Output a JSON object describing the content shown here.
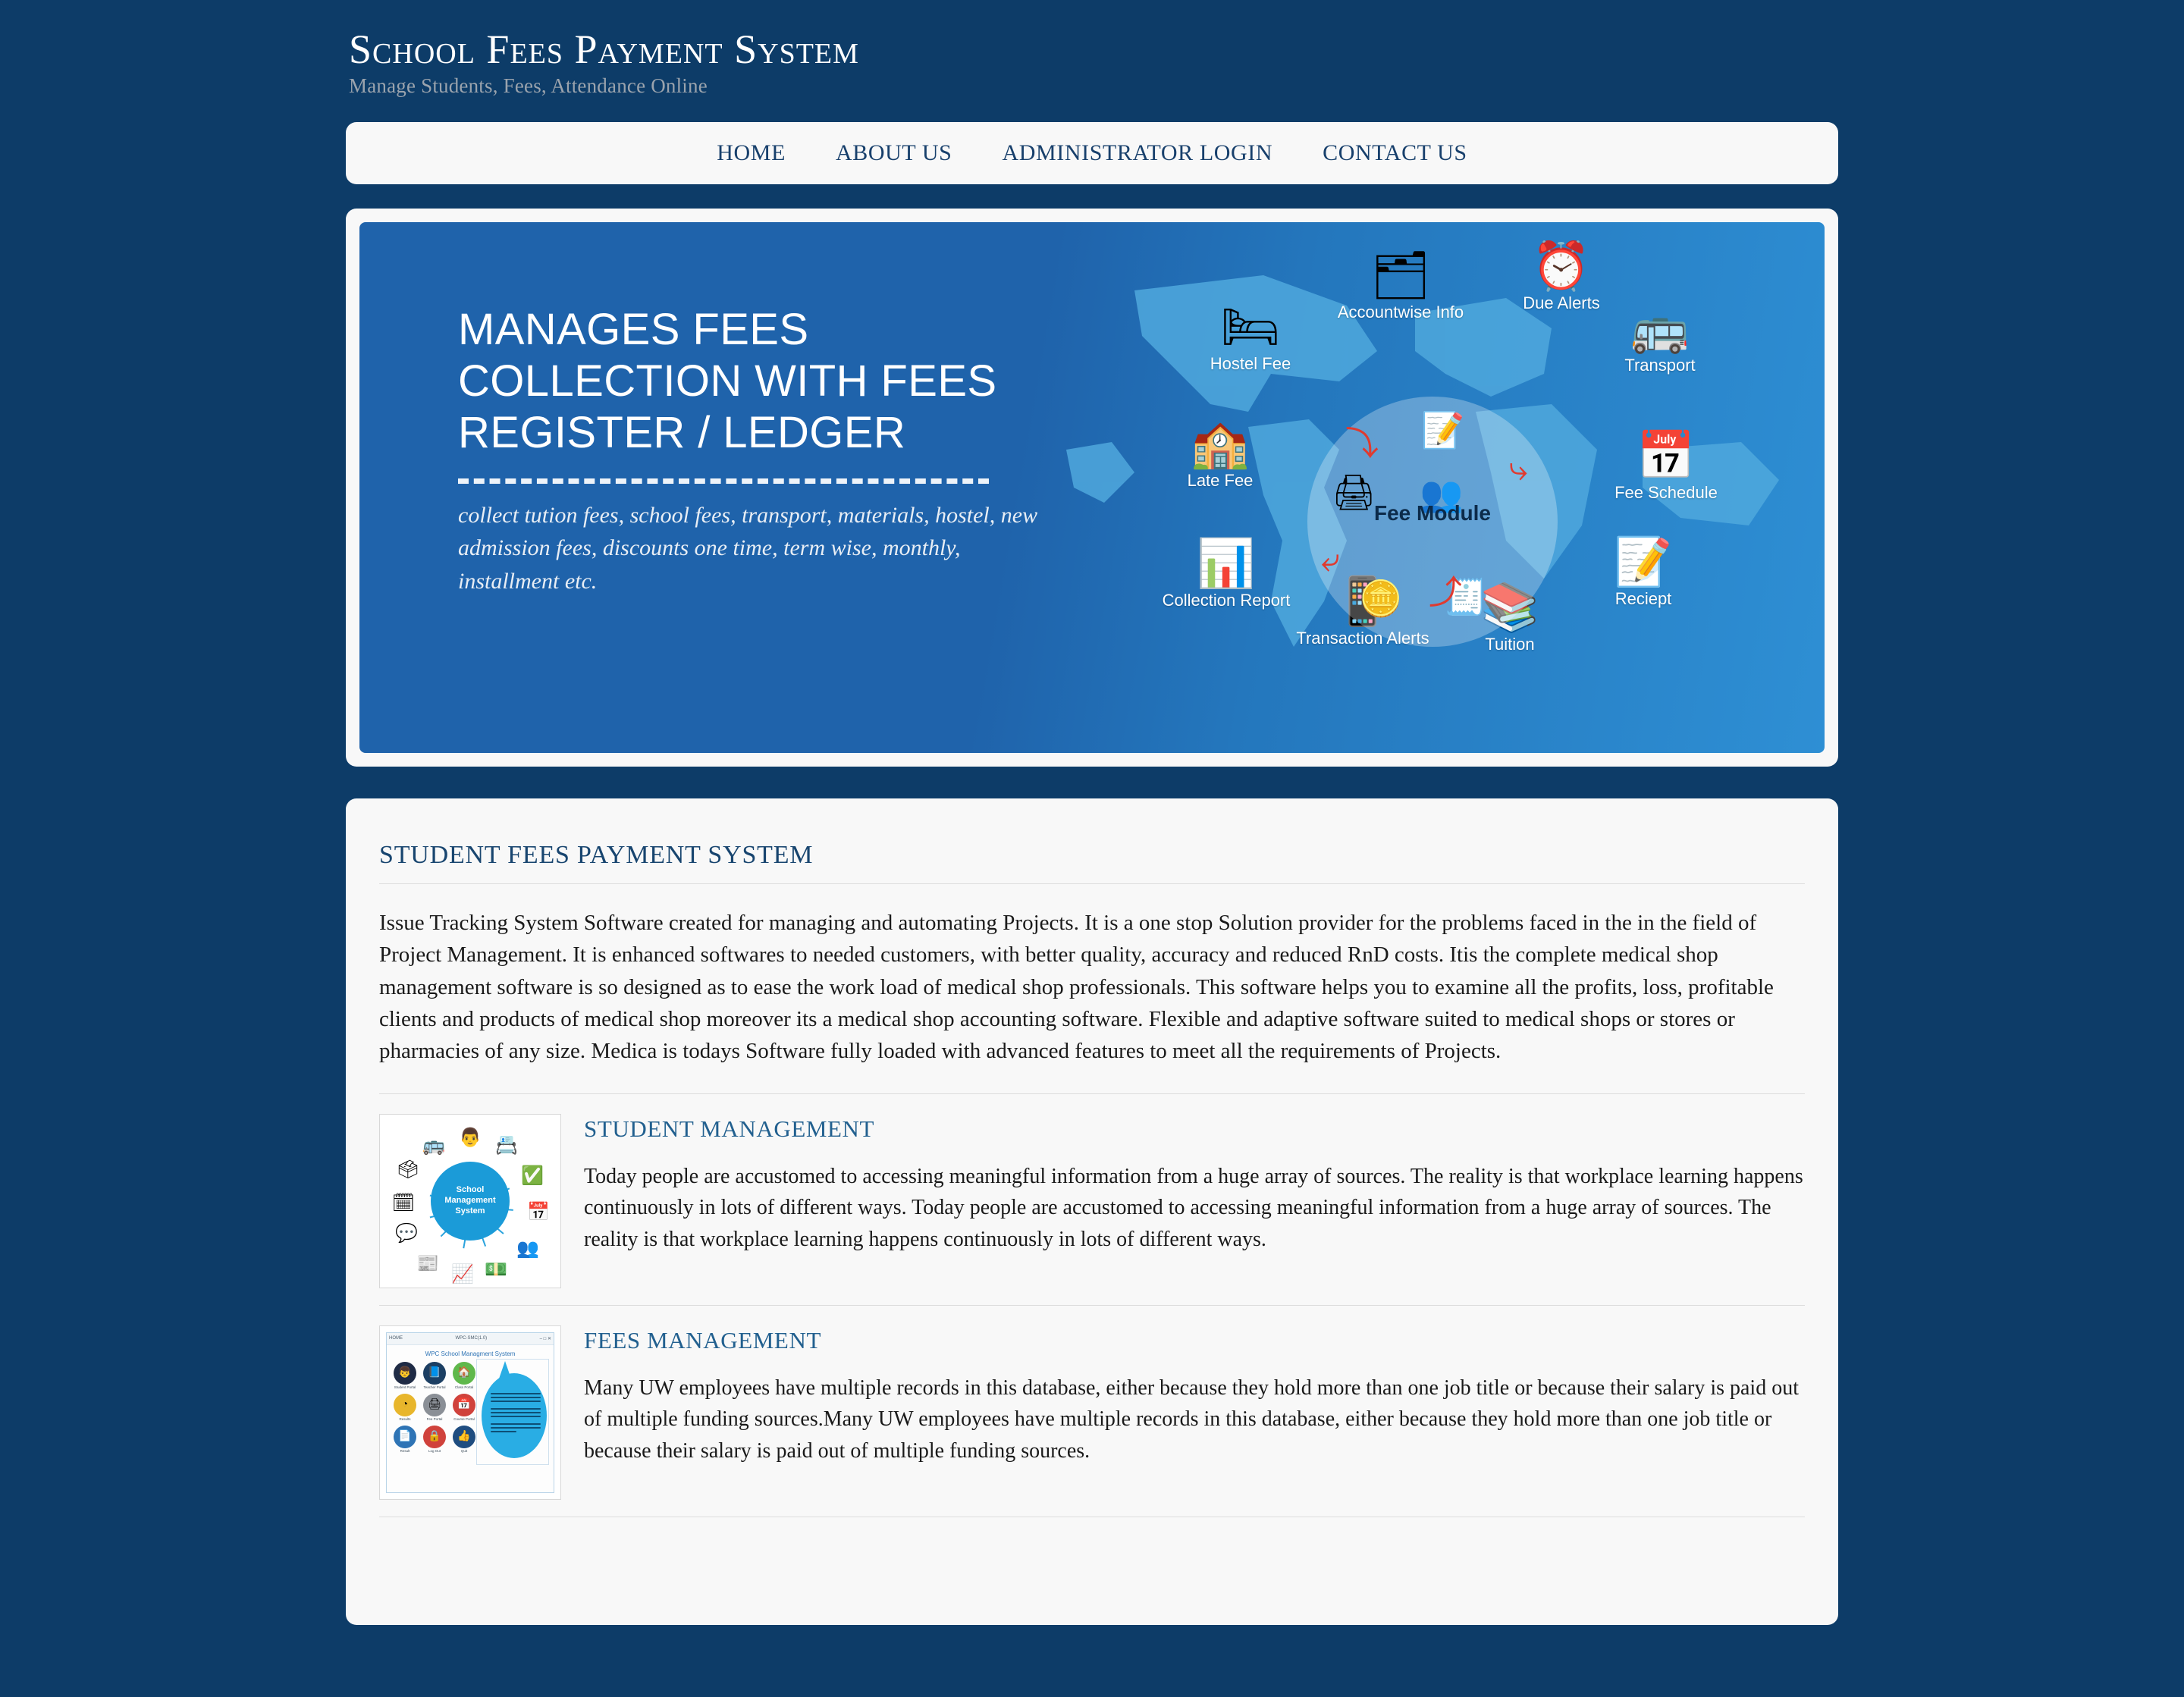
{
  "header": {
    "title": "School Fees Payment System",
    "tagline": "Manage Students, Fees, Attendance Online"
  },
  "nav": {
    "items": [
      {
        "label": "HOME"
      },
      {
        "label": "ABOUT US"
      },
      {
        "label": "ADMINISTRATOR LOGIN"
      },
      {
        "label": "CONTACT US"
      }
    ]
  },
  "banner": {
    "headline": "MANAGES FEES COLLECTION WITH FEES REGISTER / LEDGER",
    "subtext": "collect tution fees, school fees, transport, materials, hostel, new admission fees, discounts one time, term wise, monthly, installment etc.",
    "hub_label": "Fee Module",
    "nodes": [
      {
        "label": "Accountwise Info",
        "icon": "folder-documents-icon",
        "glyph": "🗂"
      },
      {
        "label": "Due Alerts",
        "icon": "alarm-clock-icon",
        "glyph": "⏰"
      },
      {
        "label": "Hostel Fee",
        "icon": "bunk-bed-icon",
        "glyph": "🛏"
      },
      {
        "label": "Transport",
        "icon": "school-bus-icon",
        "glyph": "🚌"
      },
      {
        "label": "Late Fee",
        "icon": "school-building-icon",
        "glyph": "🏫"
      },
      {
        "label": "Fee Schedule",
        "icon": "calendar-clock-icon",
        "glyph": "📅"
      },
      {
        "label": "Collection Report",
        "icon": "bar-chart-report-icon",
        "glyph": "📊"
      },
      {
        "label": "Reciept",
        "icon": "receipt-pen-icon",
        "glyph": "📝"
      },
      {
        "label": "Transaction Alerts",
        "icon": "phone-alerts-icon",
        "glyph": "📱"
      },
      {
        "label": "Tuition",
        "icon": "chalkboard-icon",
        "glyph": "📚"
      }
    ]
  },
  "content": {
    "title": "STUDENT FEES PAYMENT SYSTEM",
    "intro": "Issue Tracking System Software created for managing and automating Projects. It is a one stop Solution provider for the problems faced in the in the field of Project Management. It is enhanced softwares to needed customers, with better quality, accuracy and reduced RnD costs. Itis the complete medical shop management software is so designed as to ease the work load of medical shop professionals. This software helps you to examine all the profits, loss, profitable clients and products of medical shop moreover its a medical shop accounting software. Flexible and adaptive software suited to medical shops or stores or pharmacies of any size. Medica is todays Software fully loaded with advanced features to meet all the requirements of Projects.",
    "features": [
      {
        "title": "STUDENT MANAGEMENT",
        "text": "Today people are accustomed to accessing meaningful information from a huge array of sources. The reality is that workplace learning happens continuously in lots of different ways. Today people are accustomed to accessing meaningful information from a huge array of sources. The reality is that workplace learning happens continuously in lots of different ways.",
        "thumb": {
          "kind": "hub-diagram",
          "center_label": "School Management System",
          "spokes": [
            "🚌",
            "👔",
            "📇",
            "✅",
            "📅",
            "👥",
            "💵",
            "📈",
            "📰",
            "💬",
            "🗓",
            "🗳"
          ]
        }
      },
      {
        "title": "FEES MANAGEMENT",
        "text": "Many UW employees have multiple records in this database, either because they hold more than one job title or because their salary is paid out of multiple funding sources.Many UW employees have multiple records in this database, either because they hold more than one job title or because their salary is paid out of multiple funding sources.",
        "thumb": {
          "kind": "app-screenshot",
          "window_title": "WPC-SMC(1.0)",
          "window_menu": "HOME",
          "app_heading": "WPC School Managment System",
          "tiles": [
            {
              "label": "Student Portal",
              "glyph": "👦",
              "color": "#1f2b45"
            },
            {
              "label": "Teacher Portal",
              "glyph": "📘",
              "color": "#1c3f63"
            },
            {
              "label": "Class Portal",
              "glyph": "🏠",
              "color": "#5fb84b"
            },
            {
              "label": "Results",
              "glyph": "◔",
              "color": "#e8b62c"
            },
            {
              "label": "Fee Portal",
              "glyph": "🖨",
              "color": "#8a8f96"
            },
            {
              "label": "Course Portal",
              "glyph": "📅",
              "color": "#d0423c"
            },
            {
              "label": "Result",
              "glyph": "📄",
              "color": "#2f74b5"
            },
            {
              "label": "Log Out",
              "glyph": "🔒",
              "color": "#d0423c"
            },
            {
              "label": "Quit",
              "glyph": "👍",
              "color": "#1f4d80"
            }
          ],
          "bubble_items": [
            "Click Student : Student details",
            "Click Teacher : Teacher details",
            "Click Class : Class details",
            "Click Course : Course Details",
            "Click Records : Records saved",
            "Click Fee : Fee details",
            "Click Result : Students Result",
            "Click Logout : Close System",
            "Quit : Quit App"
          ]
        }
      }
    ]
  }
}
